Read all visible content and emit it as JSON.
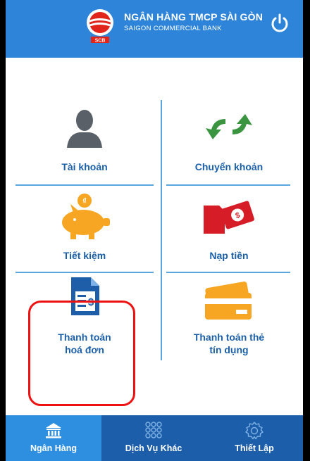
{
  "header": {
    "bank_name": "NGÂN HÀNG TMCP SÀI GÒN",
    "bank_subtitle": "SAIGON COMMERCIAL BANK",
    "logo_text": "SCB",
    "brand_color": "#2e84d8"
  },
  "menu": {
    "account_label": "Tài khoản",
    "transfer_label": "Chuyển khoản",
    "savings_label": "Tiết kiệm",
    "topup_label": "Nạp tiền",
    "bill_payment_label_1": "Thanh toán",
    "bill_payment_label_2": "hoá đơn",
    "credit_payment_label_1": "Thanh toán thẻ",
    "credit_payment_label_2": "tín dụng",
    "label_color": "#1b5fa8"
  },
  "tabbar": {
    "home_label": "Ngân Hàng",
    "services_label": "Dịch Vụ Khác",
    "settings_label": "Thiết Lập",
    "active_tab": "home",
    "active_color": "#2e8fe0",
    "bar_color": "#1c5ea9"
  }
}
